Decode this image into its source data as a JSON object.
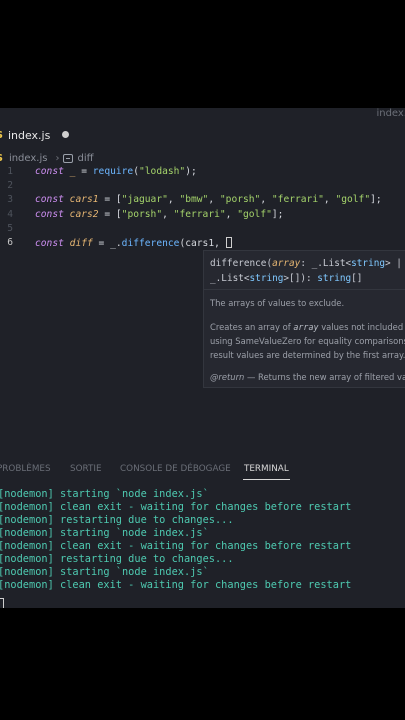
{
  "window": {
    "title_fragment": "index."
  },
  "tab": {
    "icon_label": "JS",
    "filename": "index.js"
  },
  "breadcrumb": {
    "icon_label": "JS",
    "file": "index.js",
    "symbol": "diff"
  },
  "code_lines": [
    {
      "number": "1",
      "parts": [
        [
          "kw",
          "const"
        ],
        [
          "pl",
          " "
        ],
        [
          "var",
          "_"
        ],
        [
          "pl",
          " = "
        ],
        [
          "fn",
          "require"
        ],
        [
          "pl",
          "("
        ],
        [
          "str",
          "\"lodash\""
        ],
        [
          "pl",
          ");"
        ]
      ]
    },
    {
      "number": "2",
      "parts": []
    },
    {
      "number": "3",
      "parts": [
        [
          "kw",
          "const"
        ],
        [
          "pl",
          " "
        ],
        [
          "var",
          "cars1"
        ],
        [
          "pl",
          " = ["
        ],
        [
          "str",
          "\"jaguar\""
        ],
        [
          "pl",
          ", "
        ],
        [
          "str",
          "\"bmw\""
        ],
        [
          "pl",
          ", "
        ],
        [
          "str",
          "\"porsh\""
        ],
        [
          "pl",
          ", "
        ],
        [
          "str",
          "\"ferrari\""
        ],
        [
          "pl",
          ", "
        ],
        [
          "str",
          "\"golf\""
        ],
        [
          "pl",
          "];"
        ]
      ]
    },
    {
      "number": "4",
      "parts": [
        [
          "kw",
          "const"
        ],
        [
          "pl",
          " "
        ],
        [
          "var",
          "cars2"
        ],
        [
          "pl",
          " = ["
        ],
        [
          "str",
          "\"porsh\""
        ],
        [
          "pl",
          ", "
        ],
        [
          "str",
          "\"ferrari\""
        ],
        [
          "pl",
          ", "
        ],
        [
          "str",
          "\"golf\""
        ],
        [
          "pl",
          "];"
        ]
      ]
    },
    {
      "number": "5",
      "parts": []
    },
    {
      "number": "6",
      "parts": [
        [
          "kw",
          "const"
        ],
        [
          "pl",
          " "
        ],
        [
          "var",
          "diff"
        ],
        [
          "pl",
          " = _."
        ],
        [
          "fn",
          "difference"
        ],
        [
          "pl",
          "(cars1, "
        ]
      ]
    }
  ],
  "hover": {
    "signature_line1": [
      "difference(",
      "array",
      ": _.",
      "List",
      "<",
      "string",
      "> | nul"
    ],
    "signature_line2": [
      "_.",
      "List",
      "<",
      "string",
      ">[]): ",
      "string",
      "[]"
    ],
    "param_doc": "The arrays of values to exclude.",
    "desc_line1_a": "Creates an array of ",
    "desc_line1_code": "array",
    "desc_line1_b": " values not included",
    "desc_line2": "using SameValueZero for equality comparisons.",
    "desc_line3": "result values are determined by the first array.",
    "return_tag": "@return",
    "return_text": " — Returns the new array of filtered valu"
  },
  "panel": {
    "tabs": [
      "PROBLÈMES",
      "SORTIE",
      "CONSOLE DE DÉBOGAGE",
      "TERMINAL"
    ],
    "active_tab": "TERMINAL"
  },
  "terminal": {
    "lines": [
      "[nodemon] starting `node index.js`",
      "[nodemon] clean exit - waiting for changes before restart",
      "[nodemon] restarting due to changes...",
      "[nodemon] starting `node index.js`",
      "[nodemon] clean exit - waiting for changes before restart",
      "[nodemon] restarting due to changes...",
      "[nodemon] starting `node index.js`",
      "[nodemon] clean exit - waiting for changes before restart"
    ]
  },
  "colors": {
    "editor_bg": "#1f2128",
    "terminal_text": "#4ec9b0",
    "js_badge": "#f0c94c"
  }
}
